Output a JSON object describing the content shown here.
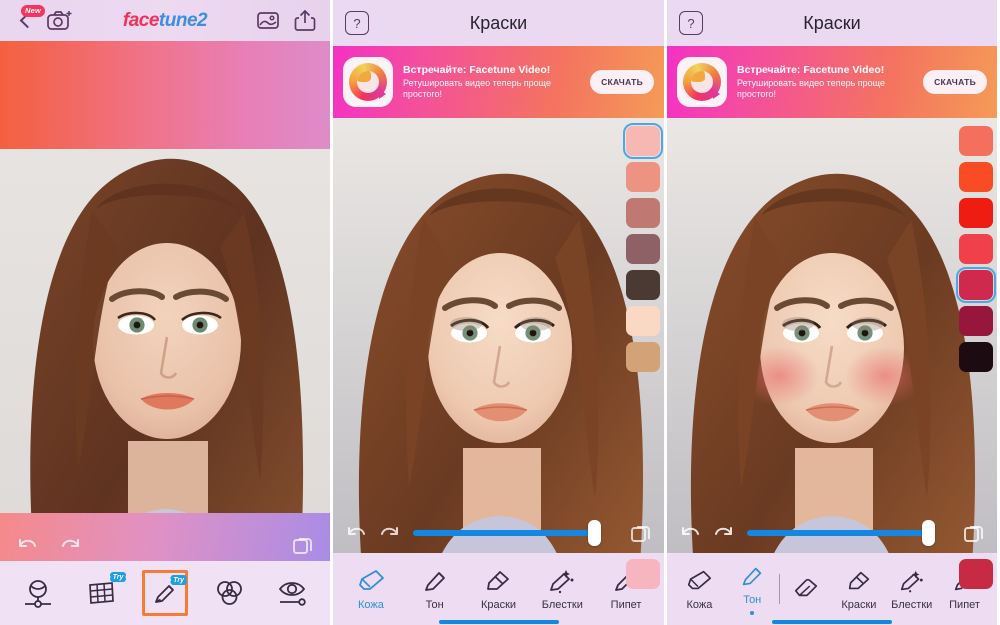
{
  "app": {
    "logo_face": "face",
    "logo_tune": "tune2",
    "new_badge": "New"
  },
  "panel1": {
    "header": {
      "back_icon": "back-chevron-icon",
      "camera_icon": "camera-icon",
      "gallery_icon": "gallery-icon",
      "share_icon": "share-icon"
    },
    "controls": {
      "undo_icon": "undo-icon",
      "redo_icon": "redo-icon",
      "compare_icon": "compare-icon"
    },
    "toolbar": [
      {
        "name": "smooth",
        "icon": "face-smooth-icon",
        "badge": ""
      },
      {
        "name": "reshape",
        "icon": "grid-reshape-icon",
        "badge": "Try"
      },
      {
        "name": "makeup",
        "icon": "brush-makeup-icon",
        "badge": "Try",
        "selected": true
      },
      {
        "name": "filters",
        "icon": "filters-circles-icon",
        "badge": ""
      },
      {
        "name": "eyes",
        "icon": "eye-icon",
        "badge": ""
      }
    ],
    "selection_color": "#f47c35"
  },
  "panel2": {
    "header": {
      "help_label": "?",
      "title": "Краски"
    },
    "promo": {
      "title": "Встречайте: Facetune Video!",
      "subtitle": "Ретушировать видео теперь проще простого!",
      "cta": "СКАЧАТЬ",
      "icon": "facetune-video-app-icon"
    },
    "swatches": [
      {
        "color": "#f7b8b4",
        "selected": true
      },
      {
        "color": "#ed9382",
        "selected": false
      },
      {
        "color": "#bf7872",
        "selected": false
      },
      {
        "color": "#8d6166",
        "selected": false
      },
      {
        "color": "#4a3a33",
        "selected": false
      },
      {
        "color": "#fbd8c4",
        "selected": false
      },
      {
        "color": "#d3a277",
        "selected": false
      }
    ],
    "swatch_bottom": {
      "color": "#f7b5c0"
    },
    "slider": {
      "value": 88,
      "fill_color": "#1487e0"
    },
    "controls": {
      "undo_icon": "undo-icon",
      "redo_icon": "redo-icon",
      "compare_icon": "compare-icon"
    },
    "toolbar": [
      {
        "label": "Кожа",
        "icon": "skin-brush-icon",
        "active": true
      },
      {
        "label": "Тон",
        "icon": "tone-brush-icon",
        "active": false
      },
      {
        "label": "Краски",
        "icon": "paint-marker-icon",
        "active": false
      },
      {
        "label": "Блестки",
        "icon": "glitter-brush-icon",
        "active": false
      },
      {
        "label": "Пипет",
        "icon": "eyedropper-icon",
        "active": false
      }
    ]
  },
  "panel3": {
    "header": {
      "help_label": "?",
      "title": "Краски"
    },
    "promo": {
      "title": "Встречайте: Facetune Video!",
      "subtitle": "Ретушировать видео теперь проще простого!",
      "cta": "СКАЧАТЬ",
      "icon": "facetune-video-app-icon"
    },
    "swatches": [
      {
        "color": "#f4705c",
        "selected": false
      },
      {
        "color": "#f94c25",
        "selected": false
      },
      {
        "color": "#ef1c12",
        "selected": false
      },
      {
        "color": "#f0404a",
        "selected": false
      },
      {
        "color": "#cf2a4e",
        "selected": true
      },
      {
        "color": "#97173c",
        "selected": false
      },
      {
        "color": "#1c0c12",
        "selected": false
      }
    ],
    "swatch_bottom": {
      "color": "#c62b43"
    },
    "slider": {
      "value": 88,
      "fill_color": "#1487e0"
    },
    "controls": {
      "undo_icon": "undo-icon",
      "redo_icon": "redo-icon",
      "compare_icon": "compare-icon"
    },
    "toolbar": [
      {
        "label": "Кожа",
        "icon": "skin-brush-icon",
        "active": false
      },
      {
        "label": "Тон",
        "icon": "tone-brush-icon",
        "active": true
      },
      {
        "label": "",
        "icon": "eraser-icon",
        "active": false
      },
      {
        "label": "Краски",
        "icon": "paint-marker-icon",
        "active": false
      },
      {
        "label": "Блестки",
        "icon": "glitter-brush-icon",
        "active": false
      },
      {
        "label": "Пипет",
        "icon": "eyedropper-icon",
        "active": false
      }
    ]
  }
}
